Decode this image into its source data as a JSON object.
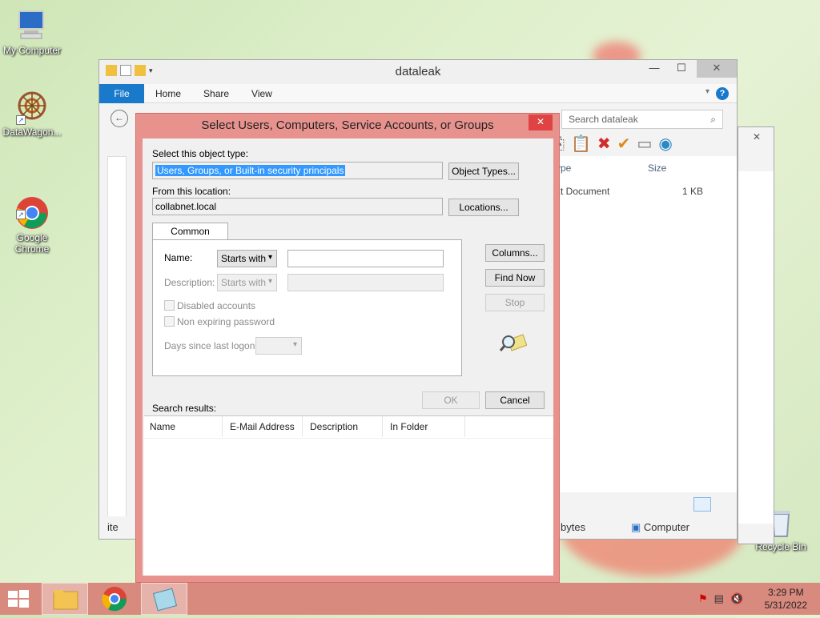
{
  "desktop": {
    "icons": [
      {
        "label": "My Computer"
      },
      {
        "label": "DataWagon..."
      },
      {
        "label": "Google\nChrome"
      },
      {
        "label": "Recycle Bin"
      }
    ]
  },
  "explorer": {
    "title": "dataleak",
    "ribbon_tabs": [
      "File",
      "Home",
      "Share",
      "View"
    ],
    "search_placeholder": "Search dataleak",
    "columns": {
      "type": "ype",
      "size": "Size"
    },
    "row": {
      "type": "xt Document",
      "size": "1 KB"
    },
    "status": {
      "items": "ite",
      "bytes": "bytes",
      "computer": "Computer"
    }
  },
  "dialog": {
    "title": "Select Users, Computers, Service Accounts, or Groups",
    "object_type_label": "Select this object type:",
    "object_type_value": "Users, Groups, or Built-in security principals",
    "object_types_button": "Object Types...",
    "location_label": "From this location:",
    "location_value": "collabnet.local",
    "locations_button": "Locations...",
    "tab_label": "Common Queries",
    "name_label": "Name:",
    "name_mode": "Starts with",
    "description_label": "Description:",
    "description_mode": "Starts with",
    "disabled_accounts": "Disabled accounts",
    "non_expiring": "Non expiring password",
    "days_since_logon": "Days since last logon:",
    "columns_button": "Columns...",
    "find_now_button": "Find Now",
    "stop_button": "Stop",
    "ok_button": "OK",
    "cancel_button": "Cancel",
    "search_results_label": "Search results:",
    "results_columns": [
      "Name",
      "E-Mail Address",
      "Description",
      "In Folder"
    ]
  },
  "taskbar": {
    "time": "3:29 PM",
    "date": "5/31/2022"
  }
}
